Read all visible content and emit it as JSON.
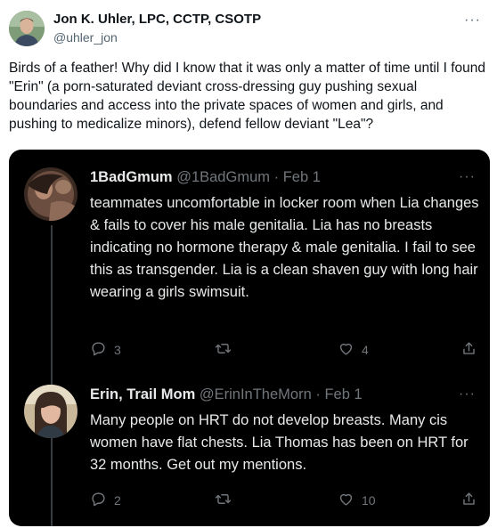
{
  "author": {
    "name": "Jon K. Uhler, LPC, CCTP, CSOTP",
    "handle": "@uhler_jon"
  },
  "tweet": {
    "text": "Birds of a feather! Why did I know that it was only a matter of time until I found \"Erin\" (a porn-saturated deviant cross-dressing guy pushing sexual boundaries and access into the private spaces of women and girls, and pushing to medicalize minors), defend fellow deviant \"Lea\"?",
    "more": "···"
  },
  "embed": {
    "replies": [
      {
        "name": "1BadGmum",
        "handle": "@1BadGmum",
        "sep": "·",
        "date": "Feb 1",
        "more": "···",
        "text": "teammates uncomfortable in locker room when Lia changes & fails to cover his male genitalia. Lia has no breasts indicating no hormone therapy & male genitalia. I fail to see this as transgender. Lia is a clean shaven guy with long hair wearing a girls swimsuit.",
        "replies_count": "3",
        "retweets_count": "",
        "likes_count": "4"
      },
      {
        "name": "Erin, Trail Mom",
        "handle": "@ErinInTheMorn",
        "sep": "·",
        "date": "Feb 1",
        "more": "···",
        "text": "Many people on HRT do not develop breasts. Many cis women have flat chests. Lia Thomas has been on HRT for 32 months. Get out my mentions.",
        "replies_count": "2",
        "retweets_count": "",
        "likes_count": "10"
      }
    ]
  },
  "icons": {
    "reply": "reply-icon",
    "retweet": "retweet-icon",
    "like": "heart-icon",
    "share": "share-icon",
    "more": "more-icon"
  }
}
